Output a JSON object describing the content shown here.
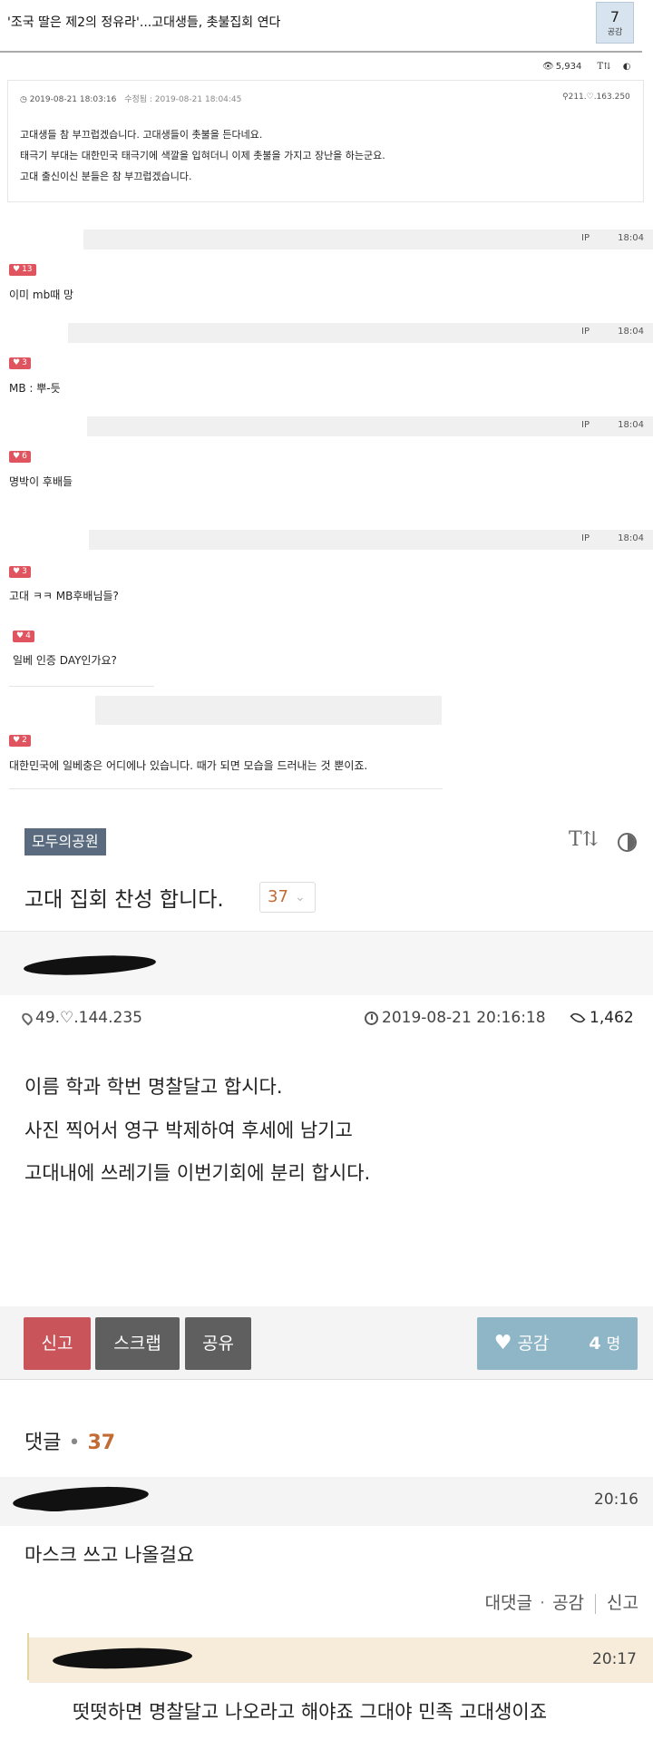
{
  "top_post": {
    "title": "'조국 딸은 제2의 정유라'...고대생들, 촛불집회 연다",
    "like_count": "7",
    "like_label": "공감",
    "views": "5,934",
    "font_toggle": "T⇅",
    "date": "2019-08-21 18:03:16",
    "edited": "수정됨 : 2019-08-21 18:04:45",
    "ip": "211.♡.163.250",
    "body": [
      "고대생들 참 부끄럽겠습니다. 고대생들이 촛불을 든다네요.",
      "태극기 부대는 대한민국 태극기에 색깔을 입혀더니 이제 촛불을 가지고 장난을 하는군요.",
      "고대 출신이신 분들은 참 부끄럽겠습니다."
    ]
  },
  "old_comments": [
    {
      "ip": "IP",
      "time": "18:04",
      "likes": "13",
      "text": "이미 mb때 망"
    },
    {
      "ip": "IP",
      "time": "18:04",
      "likes": "3",
      "text": "MB : 뿌-듯"
    },
    {
      "ip": "IP",
      "time": "18:04",
      "likes": "6",
      "text": "명박이 후배들"
    },
    {
      "ip": "IP",
      "time": "18:04",
      "likes": "3",
      "text": "고대 ㅋㅋ MB후배님들?"
    }
  ],
  "reply_comments": [
    {
      "likes": "4",
      "text": "일베 인증 DAY인가요?"
    },
    {
      "likes": "2",
      "text": "대한민국에 일베충은 어디에나 있습니다. 때가 되면 모습을 드러내는 것 뿐이죠."
    }
  ],
  "post": {
    "board": "모두의공원",
    "font_icon": "T⇅",
    "title": "고대 집회 찬성 합니다.",
    "comment_count": "37",
    "ip": "49.♡.144.235",
    "datetime": "2019-08-21 20:16:18",
    "views": "1,462",
    "body": [
      "이름 학과 학번 명찰달고 합시다.",
      "사진 찍어서 영구 박제하여 후세에 남기고",
      "고대내에 쓰레기들 이번기회에 분리 합시다."
    ],
    "buttons": {
      "report": "신고",
      "scrap": "스크랩",
      "share": "공유",
      "like": "공감",
      "like_count": "4",
      "like_unit": "명"
    }
  },
  "comments_section": {
    "label": "댓글",
    "dot": "•",
    "count": "37",
    "items": [
      {
        "time": "20:16",
        "text": "마스크 쓰고 나올걸요",
        "reply": "대댓글",
        "like": "공감",
        "report": "신고",
        "mid": "·"
      },
      {
        "time": "20:17",
        "text": "떳떳하면 명찰달고 나오라고 해야죠 그대야 민족 고대생이죠"
      }
    ]
  },
  "colors": {
    "accent_red": "#c9545a",
    "like_blue": "#8fb6c6",
    "count_orange": "#c26b35",
    "badge_red": "#e0545f"
  }
}
